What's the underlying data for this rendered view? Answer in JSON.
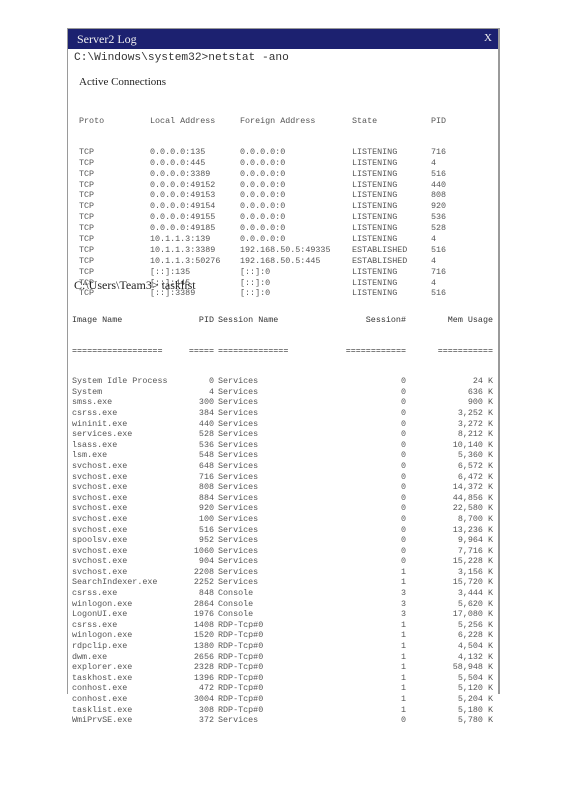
{
  "window": {
    "title": "Server2 Log",
    "close_label": "X",
    "colors": {
      "titlebar": "#1c2170",
      "title_text": "#f2f2f2",
      "border": "#9a9a9a"
    }
  },
  "netstat": {
    "command": "C:\\Windows\\system32>netstat -ano",
    "section_title": "Active Connections",
    "headers": [
      "Proto",
      "Local Address",
      "Foreign Address",
      "State",
      "PID"
    ],
    "rows": [
      [
        "TCP",
        "0.0.0.0:135",
        "0.0.0.0:0",
        "LISTENING",
        "716"
      ],
      [
        "TCP",
        "0.0.0.0:445",
        "0.0.0.0:0",
        "LISTENING",
        "4"
      ],
      [
        "TCP",
        "0.0.0.0:3389",
        "0.0.0.0:0",
        "LISTENING",
        "516"
      ],
      [
        "TCP",
        "0.0.0.0:49152",
        "0.0.0.0:0",
        "LISTENING",
        "440"
      ],
      [
        "TCP",
        "0.0.0.0:49153",
        "0.0.0.0:0",
        "LISTENING",
        "808"
      ],
      [
        "TCP",
        "0.0.0.0:49154",
        "0.0.0.0:0",
        "LISTENING",
        "920"
      ],
      [
        "TCP",
        "0.0.0.0:49155",
        "0.0.0.0:0",
        "LISTENING",
        "536"
      ],
      [
        "TCP",
        "0.0.0.0:49185",
        "0.0.0.0:0",
        "LISTENING",
        "528"
      ],
      [
        "TCP",
        "10.1.1.3:139",
        "0.0.0.0:0",
        "LISTENING",
        "4"
      ],
      [
        "TCP",
        "10.1.1.3:3389",
        "192.168.50.5:49335",
        "ESTABLISHED",
        "516"
      ],
      [
        "TCP",
        "10.1.1.3:50276",
        "192.168.50.5:445",
        "ESTABLISHED",
        "4"
      ],
      [
        "TCP",
        "[::]:135",
        "[::]:0",
        "LISTENING",
        "716"
      ],
      [
        "TCP",
        "[::]:445",
        "[::]:0",
        "LISTENING",
        "4"
      ],
      [
        "TCP",
        "[::]:3389",
        "[::]:0",
        "LISTENING",
        "516"
      ]
    ]
  },
  "tasklist": {
    "command": "C:\\Users\\Team3> tasklist",
    "headers": [
      "Image Name",
      "PID",
      "Session Name",
      "Session#",
      "Mem Usage"
    ],
    "separators": [
      "==================",
      "=====",
      "==============",
      "============",
      "==========="
    ],
    "rows": [
      [
        "System Idle Process",
        "0",
        "Services",
        "0",
        "24 K"
      ],
      [
        "System",
        "4",
        "Services",
        "0",
        "636 K"
      ],
      [
        "smss.exe",
        "300",
        "Services",
        "0",
        "900 K"
      ],
      [
        "csrss.exe",
        "384",
        "Services",
        "0",
        "3,252 K"
      ],
      [
        "wininit.exe",
        "440",
        "Services",
        "0",
        "3,272 K"
      ],
      [
        "services.exe",
        "528",
        "Services",
        "0",
        "8,212 K"
      ],
      [
        "lsass.exe",
        "536",
        "Services",
        "0",
        "10,140 K"
      ],
      [
        "lsm.exe",
        "548",
        "Services",
        "0",
        "5,360 K"
      ],
      [
        "svchost.exe",
        "648",
        "Services",
        "0",
        "6,572 K"
      ],
      [
        "svchost.exe",
        "716",
        "Services",
        "0",
        "6,472 K"
      ],
      [
        "svchost.exe",
        "808",
        "Services",
        "0",
        "14,372 K"
      ],
      [
        "svchost.exe",
        "884",
        "Services",
        "0",
        "44,856 K"
      ],
      [
        "svchost.exe",
        "920",
        "Services",
        "0",
        "22,580 K"
      ],
      [
        "svchost.exe",
        "100",
        "Services",
        "0",
        "8,700 K"
      ],
      [
        "svchost.exe",
        "516",
        "Services",
        "0",
        "13,236 K"
      ],
      [
        "spoolsv.exe",
        "952",
        "Services",
        "0",
        "9,964 K"
      ],
      [
        "svchost.exe",
        "1060",
        "Services",
        "0",
        "7,716 K"
      ],
      [
        "svchost.exe",
        "904",
        "Services",
        "0",
        "15,228 K"
      ],
      [
        "svchost.exe",
        "2208",
        "Services",
        "1",
        "3,156 K"
      ],
      [
        "SearchIndexer.exe",
        "2252",
        "Services",
        "1",
        "15,720 K"
      ],
      [
        "csrss.exe",
        "848",
        "Console",
        "3",
        "3,444 K"
      ],
      [
        "winlogon.exe",
        "2864",
        "Console",
        "3",
        "5,620 K"
      ],
      [
        "LogonUI.exe",
        "1976",
        "Console",
        "3",
        "17,080 K"
      ],
      [
        "csrss.exe",
        "1408",
        "RDP-Tcp#0",
        "1",
        "5,256 K"
      ],
      [
        "winlogon.exe",
        "1520",
        "RDP-Tcp#0",
        "1",
        "6,228 K"
      ],
      [
        "rdpclip.exe",
        "1380",
        "RDP-Tcp#0",
        "1",
        "4,504 K"
      ],
      [
        "dwm.exe",
        "2656",
        "RDP-Tcp#0",
        "1",
        "4,132 K"
      ],
      [
        "explorer.exe",
        "2328",
        "RDP-Tcp#0",
        "1",
        "58,948 K"
      ],
      [
        "taskhost.exe",
        "1396",
        "RDP-Tcp#0",
        "1",
        "5,504 K"
      ],
      [
        "conhost.exe",
        "472",
        "RDP-Tcp#0",
        "1",
        "5,120 K"
      ],
      [
        "conhost.exe",
        "3004",
        "RDP-Tcp#0",
        "1",
        "5,204 K"
      ],
      [
        "tasklist.exe",
        "308",
        "RDP-Tcp#0",
        "1",
        "5,180 K"
      ],
      [
        "WmiPrvSE.exe",
        "372",
        "Services",
        "0",
        "5,780 K"
      ]
    ]
  }
}
